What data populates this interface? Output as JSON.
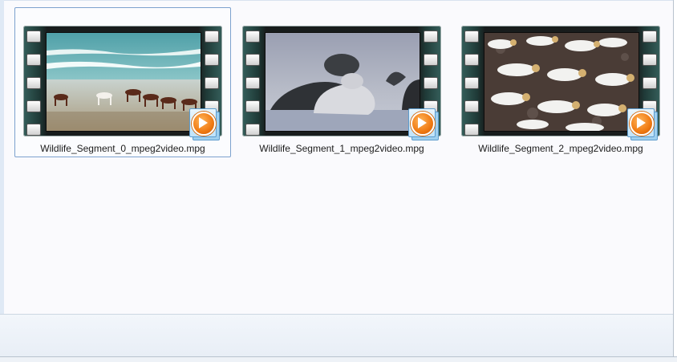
{
  "files": [
    {
      "name": "Wildlife_Segment_0_mpeg2video.mpg",
      "icon": "video-file-icon",
      "selected": true
    },
    {
      "name": "Wildlife_Segment_1_mpeg2video.mpg",
      "icon": "video-file-icon",
      "selected": false
    },
    {
      "name": "Wildlife_Segment_2_mpeg2video.mpg",
      "icon": "video-file-icon",
      "selected": false
    }
  ],
  "colors": {
    "selection_border": "#7da2ce",
    "badge_orange": "#f07a12",
    "pane_background": "#fafafd"
  }
}
